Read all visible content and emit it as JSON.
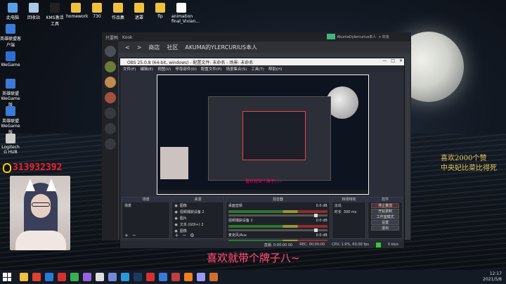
{
  "desktop": {
    "top_icons": [
      {
        "label": "此电脑",
        "color": "#5aa0e8"
      },
      {
        "label": "回收站",
        "color": "#aac8e8"
      },
      {
        "label": "KMS激活工具",
        "color": "#222222"
      },
      {
        "label": "homework",
        "color": "#f0c040"
      },
      {
        "label": "730",
        "color": "#f0c040"
      },
      {
        "label": "作品集",
        "color": "#f0c040"
      },
      {
        "label": "遮罩",
        "color": "#f0c040"
      },
      {
        "label": "flp",
        "color": "#f0c040"
      },
      {
        "label": "animation final_Vivian...",
        "color": "#ffffff"
      }
    ],
    "left_icons": [
      {
        "label": "英雄联盟客户端",
        "color": "#3c7ad8"
      },
      {
        "label": "WeGame",
        "color": "#2f6fd0"
      },
      {
        "label": "英雄联盟WeGame版",
        "color": "#3c7ad8"
      },
      {
        "label": "英雄联盟WeGame版",
        "color": "#3c7ad8"
      },
      {
        "label": "Logitech G HUB",
        "color": "#cccccc"
      }
    ]
  },
  "overlay": {
    "qq_number": "313932392",
    "right_text_line1": "喜欢2000个赞",
    "right_text_line2": "中央妃比菜比得死",
    "caption": "喜欢就带个牌子八~"
  },
  "discord": {
    "app_title": "只要鸭",
    "tab": "Kook",
    "nav_back": "<",
    "nav_forward": ">",
    "breadcrumb_store": "商店",
    "breadcrumb_community": "社区",
    "breadcrumb_user": "AKUMA的YLERCURIUS本人",
    "user_tag": "AkumaDylercurius本人",
    "user_status": "+ 好友"
  },
  "obs": {
    "window_title": "OBS 25.0.8 (64-bit, windows) - 配置文件: 未命名 - 场景: 未命名",
    "menu": [
      "文件(F)",
      "编辑(E)",
      "视图(V)",
      "停靠部件(D)",
      "配置文件(P)",
      "场景集合(S)",
      "工具(T)",
      "帮助(H)"
    ],
    "preview_caption": "喜欢就带个牌子八~",
    "docks": {
      "scenes": {
        "header": "场景",
        "items": [
          "场景"
        ]
      },
      "sources": {
        "header": "来源",
        "items": [
          "图像",
          "视频捕获设备 2",
          "图片",
          "文本 (GDI+) 2",
          "图像"
        ]
      },
      "mixer": {
        "header": "混音器",
        "channels": [
          {
            "name": "桌面音频",
            "db": "0.0 dB"
          },
          {
            "name": "视频捕获设备 2",
            "db": "0.0 dB"
          },
          {
            "name": "麦克风/Aux",
            "db": "0.0 dB"
          }
        ]
      },
      "transitions": {
        "header": "转场特效",
        "type": "淡出",
        "duration_label": "时长",
        "duration": "300 ms"
      },
      "controls": {
        "header": "控件",
        "buttons": [
          "停止推流",
          "开始录制",
          "工作室模式",
          "设置",
          "退出"
        ]
      }
    },
    "status": {
      "live": "直播: 0:00:00 00",
      "rec": "REC: 00:00:00",
      "cpu": "CPU: 1.9%, 60.00 fps",
      "kbps": "0 kb/s"
    }
  },
  "taskbar": {
    "apps": [
      {
        "name": "explorer",
        "color": "#f0c040"
      },
      {
        "name": "chrome",
        "color": "#e04030"
      },
      {
        "name": "photoshop",
        "color": "#2a7ad8"
      },
      {
        "name": "music",
        "color": "#d83030"
      },
      {
        "name": "wechat",
        "color": "#3cb050"
      },
      {
        "name": "premiere",
        "color": "#9a60e0"
      },
      {
        "name": "obs",
        "color": "#dddddd"
      },
      {
        "name": "discord",
        "color": "#7289da"
      },
      {
        "name": "qq",
        "color": "#2a9ae0"
      },
      {
        "name": "steam",
        "color": "#1a3a60"
      },
      {
        "name": "netease",
        "color": "#d83030"
      },
      {
        "name": "wegame",
        "color": "#3c7ad8"
      },
      {
        "name": "zy",
        "color": "#c04040"
      },
      {
        "name": "vlc",
        "color": "#f08020"
      },
      {
        "name": "ae",
        "color": "#9999ff"
      },
      {
        "name": "an",
        "color": "#d07030"
      }
    ],
    "time": "12:17",
    "date": "2021/5/8"
  }
}
